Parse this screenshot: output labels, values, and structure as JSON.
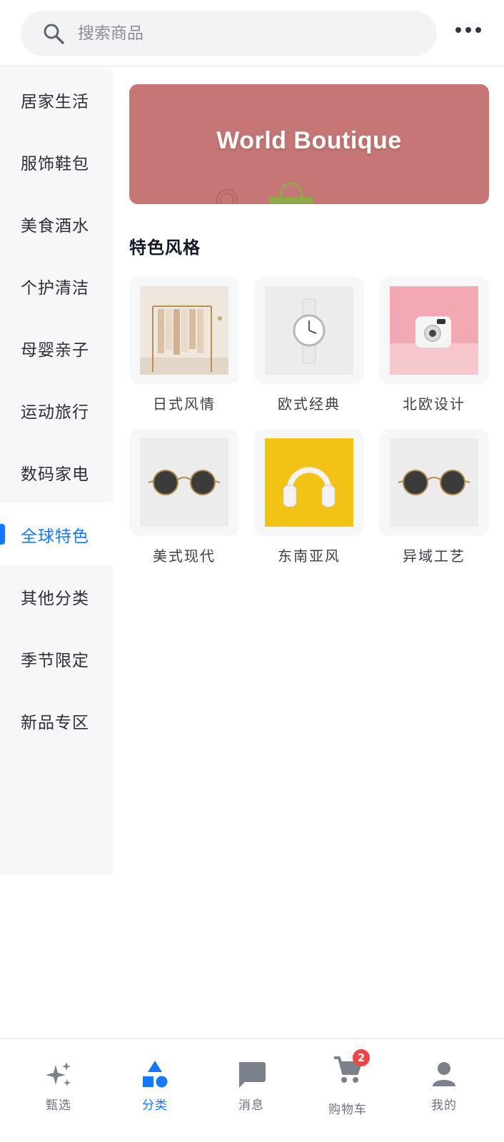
{
  "search": {
    "placeholder": "搜索商品",
    "icon": "search-icon"
  },
  "header": {
    "more_icon": "more-horizontal-icon"
  },
  "sidebar": {
    "items": [
      {
        "label": "居家生活"
      },
      {
        "label": "服饰鞋包"
      },
      {
        "label": "美食酒水"
      },
      {
        "label": "个护清洁"
      },
      {
        "label": "母婴亲子"
      },
      {
        "label": "运动旅行"
      },
      {
        "label": "数码家电"
      },
      {
        "label": "全球特色",
        "active": true
      },
      {
        "label": "其他分类"
      },
      {
        "label": "季节限定"
      },
      {
        "label": "新品专区"
      }
    ]
  },
  "banner": {
    "title": "World Boutique",
    "color": "#c67775"
  },
  "section": {
    "title": "特色风格"
  },
  "styles": [
    {
      "label": "日式风情",
      "image": "clothing-rack-photo"
    },
    {
      "label": "欧式经典",
      "image": "wristwatch-photo"
    },
    {
      "label": "北欧设计",
      "image": "instant-camera-photo"
    },
    {
      "label": "美式现代",
      "image": "round-sunglasses-photo"
    },
    {
      "label": "东南亚风",
      "image": "headphones-photo"
    },
    {
      "label": "异域工艺",
      "image": "round-sunglasses-photo"
    }
  ],
  "tabbar": {
    "tabs": [
      {
        "label": "甄选",
        "icon": "sparkle-icon"
      },
      {
        "label": "分类",
        "icon": "category-shapes-icon",
        "active": true
      },
      {
        "label": "消息",
        "icon": "message-icon"
      },
      {
        "label": "购物车",
        "icon": "cart-icon",
        "badge": "2"
      },
      {
        "label": "我的",
        "icon": "user-icon"
      }
    ]
  },
  "colors": {
    "accent": "#1677ff",
    "badge": "#ef4444",
    "sidebar_bg": "#f6f7f9"
  }
}
